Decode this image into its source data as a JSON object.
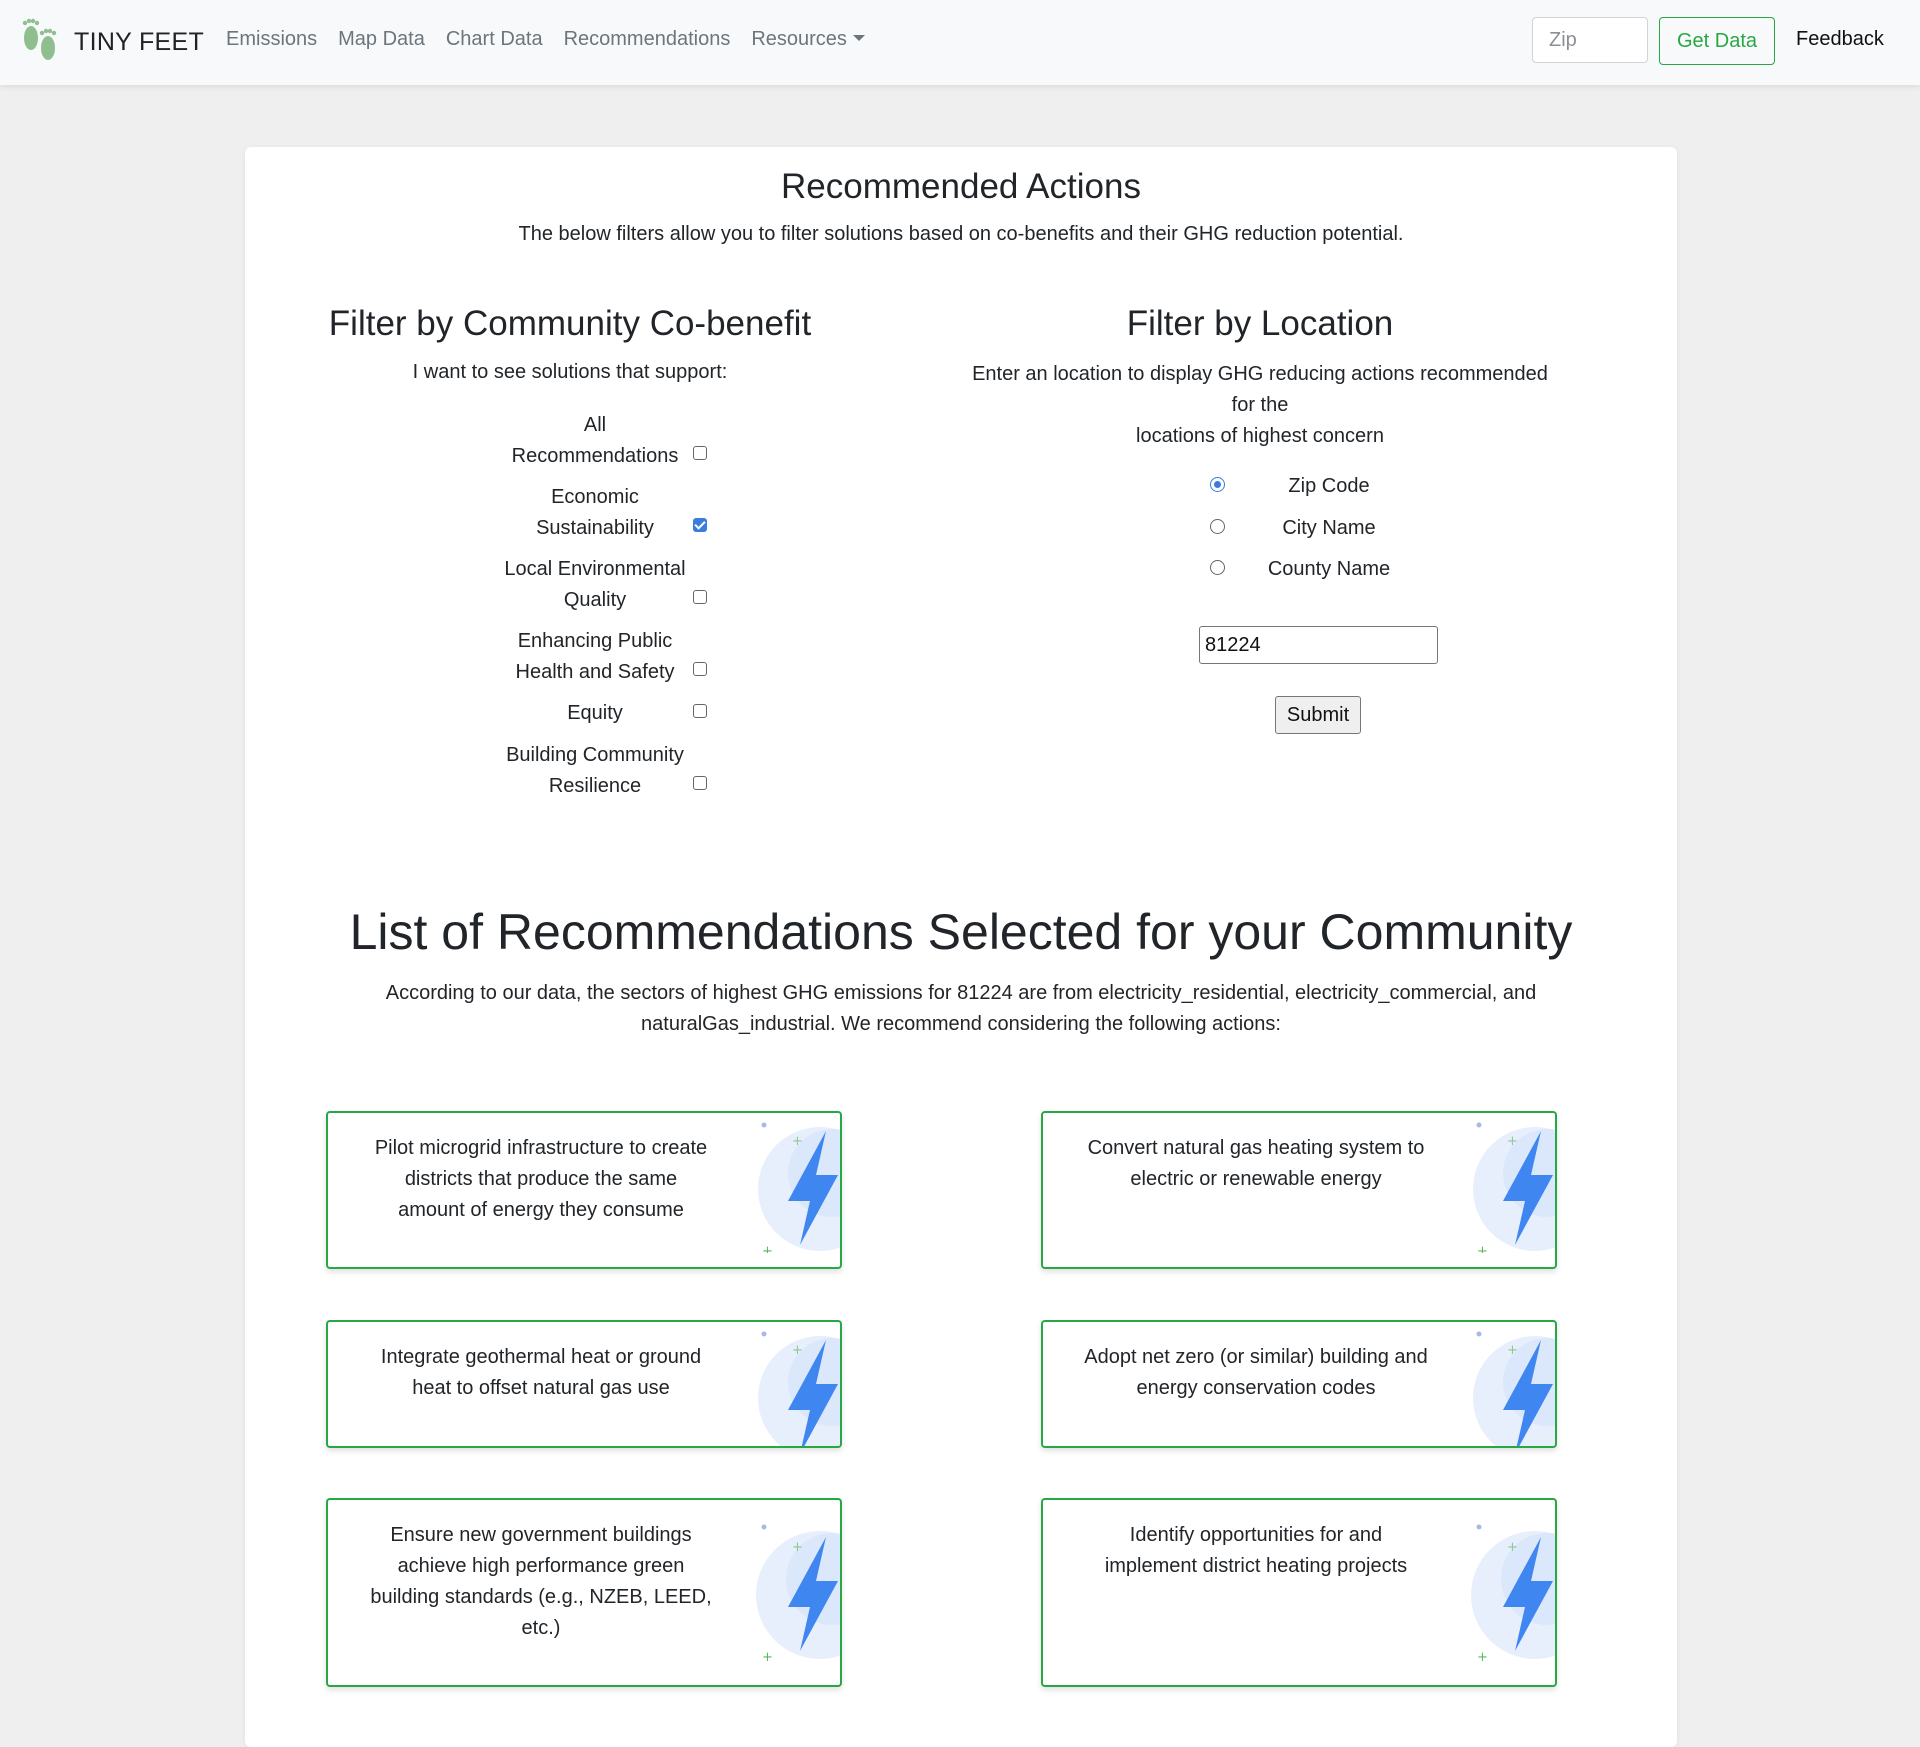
{
  "navbar": {
    "brand": "TINY FEET",
    "links": [
      "Emissions",
      "Map Data",
      "Chart Data",
      "Recommendations",
      "Resources"
    ],
    "zip_placeholder": "Zip",
    "get_data_label": "Get Data",
    "feedback_label": "Feedback"
  },
  "header": {
    "title": "Recommended Actions",
    "subtitle": "The below filters allow you to filter solutions based on co-benefits and their GHG reduction potential."
  },
  "cobenefit": {
    "title": "Filter by Community Co-benefit",
    "subtitle": "I want to see solutions that support:",
    "options": [
      {
        "line1": "All",
        "line2": "Recommendations",
        "checked": false
      },
      {
        "line1": "Economic",
        "line2": "Sustainability",
        "checked": true
      },
      {
        "line1": "Local Environmental",
        "line2": "Quality",
        "checked": false
      },
      {
        "line1": "Enhancing Public",
        "line2": "Health and Safety",
        "checked": false
      },
      {
        "line1": "Equity",
        "line2": "",
        "checked": false
      },
      {
        "line1": "Building Community",
        "line2": "Resilience",
        "checked": false
      }
    ]
  },
  "location": {
    "title": "Filter by Location",
    "subtitle_line1": "Enter an location to display GHG reducing actions recommended for the",
    "subtitle_line2": "locations of highest concern",
    "radios": [
      {
        "label": "Zip Code",
        "selected": true
      },
      {
        "label": "City Name",
        "selected": false
      },
      {
        "label": "County Name",
        "selected": false
      }
    ],
    "input_value": "81224",
    "submit_label": "Submit"
  },
  "recommendations": {
    "title": "List of Recommendations Selected for your Community",
    "desc_line1": "According to our data, the sectors of highest GHG emissions for 81224 are from electricity_residential, electricity_commercial, and",
    "desc_line2": "naturalGas_industrial. We recommend considering the following actions:",
    "items": [
      {
        "lines": [
          "Pilot microgrid infrastructure to create",
          "districts that produce the same",
          "amount of energy they consume"
        ]
      },
      {
        "lines": [
          "Convert natural gas heating system to",
          "electric or renewable energy"
        ]
      },
      {
        "lines": [
          "Integrate geothermal heat or ground",
          "heat to offset natural gas use"
        ]
      },
      {
        "lines": [
          "Adopt net zero (or similar) building and",
          "energy conservation codes"
        ]
      },
      {
        "lines": [
          "Ensure new government buildings",
          "achieve high performance green",
          "building standards (e.g., NZEB, LEED,",
          "etc.)"
        ]
      },
      {
        "lines": [
          "Identify opportunities for and",
          "implement district heating projects"
        ]
      }
    ]
  },
  "colors": {
    "accent_green": "#28a745",
    "bolt_blue": "#3f86f0",
    "checkbox_blue": "#3b7ddd"
  }
}
